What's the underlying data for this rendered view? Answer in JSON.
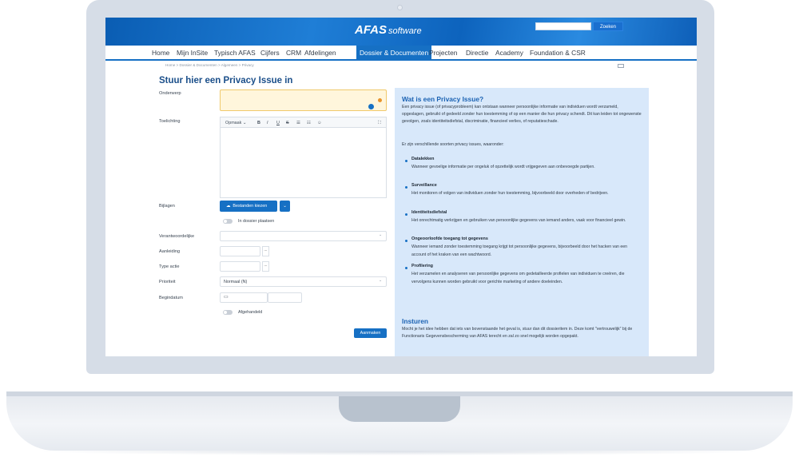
{
  "header": {
    "logo_brand": "AFAS",
    "logo_suffix": "software",
    "search_button": "Zoeken",
    "search_placeholder": ""
  },
  "nav": {
    "items": [
      "Home",
      "Mijn InSite",
      "Typisch AFAS",
      "Cijfers",
      "CRM",
      "Afdelingen",
      "Dossier & Documenten",
      "Projecten",
      "Directie",
      "Academy",
      "Foundation & CSR"
    ],
    "active": "Dossier & Documenten"
  },
  "breadcrumb": "Home  >  Dossier & Documenten  >  Algemeen  >  Privacy",
  "form": {
    "title": "Stuur hier een Privacy Issue in",
    "labels": {
      "onderwerp": "Onderwerp",
      "toelichting": "Toelichting",
      "bijlagen": "Bijlagen",
      "verantwoordelijke": "Verantwoordelijke",
      "aanleiding": "Aanleiding",
      "type_actie": "Type actie",
      "prioriteit": "Prioriteit",
      "begindatum": "Begindatum"
    },
    "toolbar": {
      "format": "Opmaak",
      "bold": "B",
      "italic": "I",
      "underline": "U",
      "strike": "S",
      "ul": "☰",
      "ol": "☷",
      "emoji": "☺",
      "expand": "⛶"
    },
    "upload_button": "Bestanden kiezen",
    "toggle_dossier": "In dossier plaatsen",
    "ellipsis": "...",
    "prioriteit_value": "Normaal (N)",
    "toggle_afgehandeld": "Afgehandeld",
    "submit": "Aanmaken"
  },
  "info": {
    "heading1": "Wat is een Privacy Issue?",
    "intro": "Een privacy issue (of privacyprobleem) kan ontstaan wanneer persoonlijke informatie van individuen wordt verzameld, opgeslagen, gebruikt of gedeeld zonder hun toestemming of op een manier die hun privacy schendt. Dit kan leiden tot ongewenste gevolgen, zoals identiteitsdiefstal, discriminatie, financieel verlies, of reputatieschade.",
    "sorts": "Er zijn verschillende soorten privacy issues, waaronder:",
    "items": [
      {
        "term": "Datalekken",
        "desc": "Wanneer gevoelige informatie per ongeluk of opzettelijk wordt vrijgegeven aan onbevoegde partijen."
      },
      {
        "term": "Surveillance",
        "desc": "Het monitoren of volgen van individuen zonder hun toestemming, bijvoorbeeld door overheden of bedrijven."
      },
      {
        "term": "Identiteitsdiefstal",
        "desc": "Het onrechtmatig verkrijgen en gebruiken van persoonlijke gegevens van iemand anders, vaak voor financieel gewin."
      },
      {
        "term": "Ongeoorloofde toegang tot gegevens",
        "desc": "Wanneer iemand zonder toestemming toegang krijgt tot persoonlijke gegevens, bijvoorbeeld door het hacken van een account of het kraken van een wachtwoord."
      },
      {
        "term": "Profilering",
        "desc": "Het verzamelen en analyseren van persoonlijke gegevens om gedetailleerde profielen van individuen te creëren, die vervolgens kunnen worden gebruikt voor gerichte marketing of andere doeleinden."
      }
    ],
    "heading2": "Insturen",
    "insturen": "Mocht je het idee hebben dat iets van bovenstaande het geval is, stuur dan dit dossieritem in. Deze komt \"vertrouwelijk\" bij de Functionaris Gegevensbescherming van AFAS terecht en zal zo snel mogelijk worden opgepakt."
  }
}
